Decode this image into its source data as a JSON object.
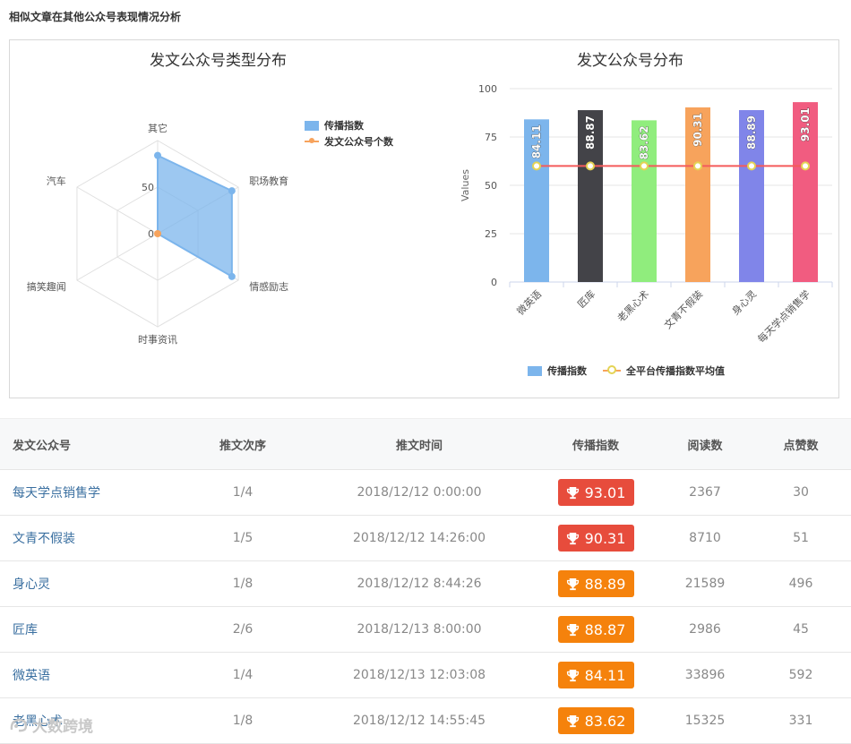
{
  "page_title": "相似文章在其他公众号表现情况分析",
  "colors": {
    "spread": "#7cb5ec",
    "accounts": "#f7a35c",
    "avg_line": "#f45b5b",
    "avg_marker": "#e4d354",
    "badge_red": "#e74c3c",
    "badge_orange": "#f5820c",
    "link": "#3a6fa0"
  },
  "chart_data": [
    {
      "type": "radar",
      "title": "发文公众号类型分布",
      "axes": [
        "其它",
        "职场教育",
        "情感励志",
        "时事资讯",
        "搞笑趣闻",
        "汽车"
      ],
      "radial_ticks": [
        "0",
        "50"
      ],
      "rmin": 0,
      "rmax": 100,
      "legend_position": "top-right",
      "series": [
        {
          "name": "传播指数",
          "values": [
            84,
            92,
            92,
            0,
            0,
            0
          ]
        },
        {
          "name": "发文公众号个数",
          "values": [
            1,
            1,
            1,
            1,
            1,
            1
          ]
        }
      ]
    },
    {
      "type": "bar",
      "title": "发文公众号分布",
      "ylabel": "Values",
      "ylim": [
        0,
        100
      ],
      "yticks": [
        "0",
        "25",
        "50",
        "75",
        "100"
      ],
      "categories": [
        "微英语",
        "匠库",
        "老黑心术",
        "文青不假装",
        "身心灵",
        "每天学点销售学"
      ],
      "bar_colors": [
        "#7cb5ec",
        "#434348",
        "#90ed7d",
        "#f7a35c",
        "#8085e9",
        "#f15c80"
      ],
      "legend_position": "bottom",
      "series": [
        {
          "name": "传播指数",
          "type": "bar",
          "values": [
            84.11,
            88.87,
            83.62,
            90.31,
            88.89,
            93.01
          ],
          "labels": [
            "84.11",
            "88.87",
            "83.62",
            "90.31",
            "88.89",
            "93.01"
          ]
        },
        {
          "name": "全平台传播指数平均值",
          "type": "line",
          "values": [
            60,
            60,
            60,
            60,
            60,
            60
          ]
        }
      ]
    }
  ],
  "table": {
    "headers": [
      "发文公众号",
      "推文次序",
      "推文时间",
      "传播指数",
      "阅读数",
      "点赞数"
    ],
    "rows": [
      {
        "account": "每天学点销售学",
        "order": "1/4",
        "time": "2018/12/12 0:00:00",
        "index": "93.01",
        "level": "red",
        "reads": "2367",
        "likes": "30"
      },
      {
        "account": "文青不假装",
        "order": "1/5",
        "time": "2018/12/12 14:26:00",
        "index": "90.31",
        "level": "red",
        "reads": "8710",
        "likes": "51"
      },
      {
        "account": "身心灵",
        "order": "1/8",
        "time": "2018/12/12 8:44:26",
        "index": "88.89",
        "level": "orange",
        "reads": "21589",
        "likes": "496"
      },
      {
        "account": "匠库",
        "order": "2/6",
        "time": "2018/12/13 8:00:00",
        "index": "88.87",
        "level": "orange",
        "reads": "2986",
        "likes": "45"
      },
      {
        "account": "微英语",
        "order": "1/4",
        "time": "2018/12/13 12:03:08",
        "index": "84.11",
        "level": "orange",
        "reads": "33896",
        "likes": "592"
      },
      {
        "account": "老黑心术",
        "order": "1/8",
        "time": "2018/12/12 14:55:45",
        "index": "83.62",
        "level": "orange",
        "reads": "15325",
        "likes": "331"
      }
    ]
  },
  "watermark": {
    "text": "大数跨境",
    "icon": "watermark-logo-icon"
  }
}
